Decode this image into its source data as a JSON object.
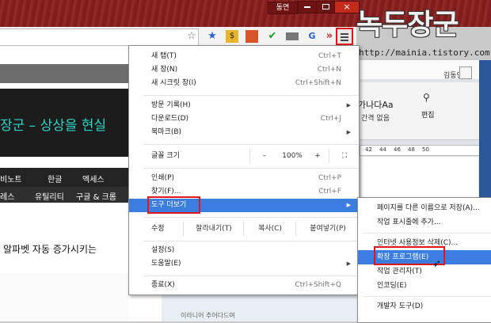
{
  "window": {
    "user_badge": "동연",
    "close_glyph": "×"
  },
  "watermark": {
    "title": "녹두장군",
    "url": "http://mainia.tistory.com"
  },
  "toolbar": {
    "icons": [
      "bookmark-star-icon",
      "blue-star-icon",
      "yellow-extension-icon",
      "photo-extension-icon",
      "green-check-icon",
      "keyboard-icon",
      "translate-icon",
      "more-extensions-icon"
    ],
    "more_glyph": "»"
  },
  "page": {
    "hero_text": "장군 – 상상을 현실",
    "nav1": [
      "비노트",
      "한글",
      "엑세스"
    ],
    "nav2": [
      "레스",
      "유틸리티",
      "구글 & 크롬"
    ],
    "article_title": "알파벳 자동 증가시키는",
    "bottom_text": "이라니어 추어다드며"
  },
  "word": {
    "user_name": "김동연",
    "font_sample": "가나다Aa",
    "spacing_label": "간격 없음",
    "edit_label": "편집",
    "ruler_marks": [
      "42",
      "44",
      "46",
      "48",
      "50"
    ]
  },
  "menu": {
    "items_top": [
      {
        "label": "새 탭(T)",
        "shortcut": "Ctrl+T"
      },
      {
        "label": "새 창(N)",
        "shortcut": "Ctrl+N"
      },
      {
        "label": "새 시크릿 창(I)",
        "shortcut": "Ctrl+Shift+N"
      }
    ],
    "items_history": [
      {
        "label": "방문 기록(H)",
        "shortcut": ""
      },
      {
        "label": "다운로드(D)",
        "shortcut": "Ctrl+J"
      },
      {
        "label": "북마크(B)",
        "shortcut": ""
      }
    ],
    "zoom": {
      "label": "글꼴 크기",
      "minus": "–",
      "value": "100%",
      "plus": "+",
      "fullscreen": "⛶"
    },
    "print": {
      "label": "인쇄(P)",
      "shortcut": "Ctrl+P"
    },
    "find": {
      "label": "찾기(F)...",
      "shortcut": "Ctrl+F"
    },
    "more_tools": {
      "label": "도구 더보기"
    },
    "edit": {
      "label": "수정",
      "cut": "잘라내기(T)",
      "copy": "복사(C)",
      "paste": "붙여넣기(P)"
    },
    "settings": {
      "label": "설정(S)"
    },
    "help": {
      "label": "도움말(E)"
    },
    "exit": {
      "label": "종료(X)",
      "shortcut": "Ctrl+Shift+Q"
    }
  },
  "submenu": {
    "items": [
      {
        "label": "페이지를 다른 이름으로 저장(A)...",
        "shortcut": ""
      },
      {
        "label": "작업 표시줄에 추가...",
        "shortcut": ""
      },
      {
        "label": "인터넷 사용정보 삭제(C)...",
        "shortcut": ""
      },
      {
        "label": "확장 프로그램(E)",
        "shortcut": ""
      },
      {
        "label": "작업 관리자(T)",
        "shortcut": ""
      },
      {
        "label": "인코딩(E)",
        "shortcut": ""
      },
      {
        "label": "개발자 도구(D)",
        "shortcut": ""
      }
    ]
  }
}
